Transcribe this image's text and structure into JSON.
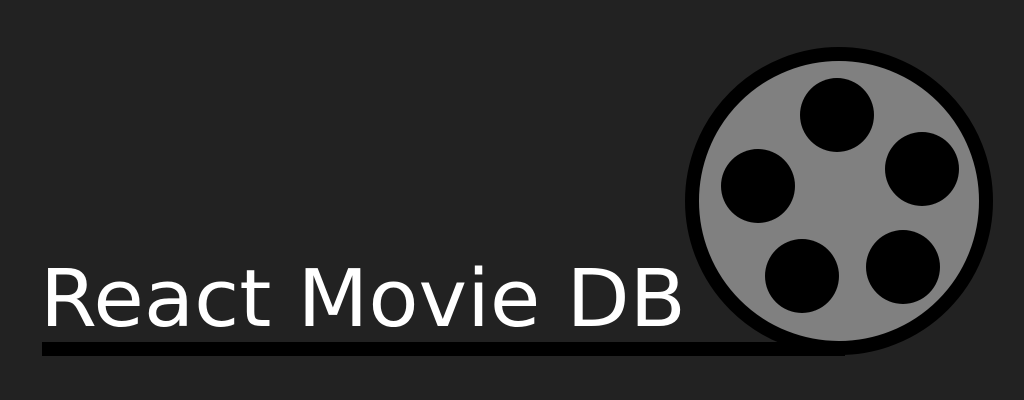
{
  "logo": {
    "title": "React Movie DB",
    "icon": "film-reel-icon",
    "colors": {
      "background": "#222222",
      "text": "#ffffff",
      "reel": "#808080",
      "outline": "#000000"
    }
  }
}
